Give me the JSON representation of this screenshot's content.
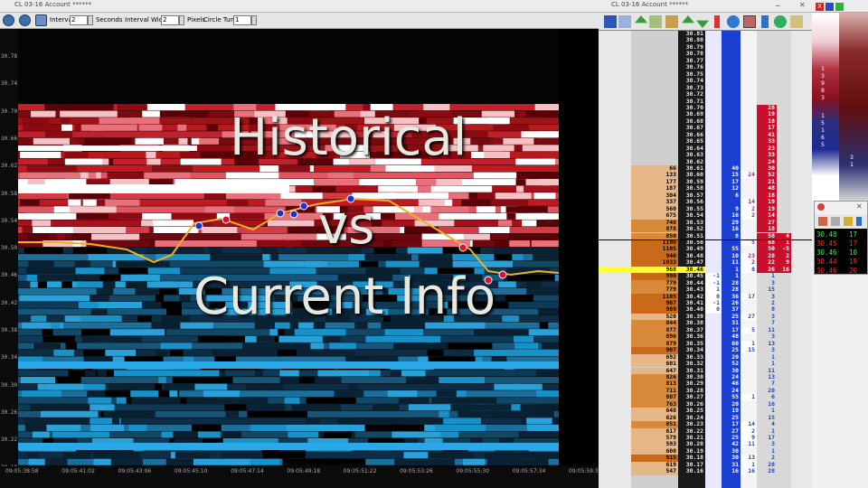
{
  "left_window": {
    "title": "CL 03-16  Account ******",
    "toolbar": {
      "interval_label": "Interval",
      "interval_value": "2",
      "seconds_label": "Seconds",
      "interval_width_label": "Interval Width",
      "interval_width_value": "2",
      "pixels_label": "Pixels",
      "circle_tuner_label": "Circle Tuner",
      "circle_tuner_value": "1"
    },
    "price_axis": [
      "30.78",
      "30.74",
      "30.70",
      "30.66",
      "30.62",
      "30.58",
      "30.54",
      "30.50",
      "30.46",
      "30.42",
      "30.38",
      "30.34",
      "30.30",
      "30.26",
      "30.22",
      "30.18"
    ],
    "time_axis": [
      "09:05:38:58",
      "09:05:41:02",
      "09:05:43:06",
      "09:05:45:10",
      "09:05:47:14",
      "09:05:49:18",
      "09:05:51:22",
      "09:05:53:26",
      "09:05:55:30",
      "09:05:57:34",
      "09:05:59:38"
    ],
    "overlay": {
      "line1": "Historical",
      "line2": "vs",
      "line3": "Current Info"
    }
  },
  "right_window": {
    "title": "CL 03-16  Account ******",
    "current_price": "30.46",
    "ladder": [
      {
        "p": "30.81",
        "v": "",
        "a": "",
        "b": "",
        "s": ""
      },
      {
        "p": "30.80",
        "v": "",
        "a": "",
        "b": "",
        "s": ""
      },
      {
        "p": "30.79",
        "v": "",
        "a": "",
        "b": "",
        "s": ""
      },
      {
        "p": "30.78",
        "v": "",
        "a": "",
        "b": "",
        "s": ""
      },
      {
        "p": "30.77",
        "v": "",
        "a": "",
        "b": "",
        "s": ""
      },
      {
        "p": "30.76",
        "v": "",
        "a": "",
        "b": "",
        "s": ""
      },
      {
        "p": "30.75",
        "v": "",
        "a": "",
        "b": "",
        "s": ""
      },
      {
        "p": "30.74",
        "v": "",
        "a": "",
        "b": "",
        "s": ""
      },
      {
        "p": "30.73",
        "v": "",
        "a": "",
        "b": "",
        "s": ""
      },
      {
        "p": "30.72",
        "v": "",
        "a": "",
        "b": "",
        "s": ""
      },
      {
        "p": "30.71",
        "v": "",
        "a": "",
        "b": "",
        "s": ""
      },
      {
        "p": "30.70",
        "v": "",
        "a": "",
        "b": "",
        "s": "28"
      },
      {
        "p": "30.69",
        "v": "",
        "a": "",
        "b": "",
        "s": "19"
      },
      {
        "p": "30.68",
        "v": "",
        "a": "",
        "b": "",
        "s": "18"
      },
      {
        "p": "30.67",
        "v": "",
        "a": "",
        "b": "",
        "s": "17"
      },
      {
        "p": "30.66",
        "v": "",
        "a": "",
        "b": "",
        "s": "41"
      },
      {
        "p": "30.65",
        "v": "",
        "a": "",
        "b": "",
        "s": "33"
      },
      {
        "p": "30.64",
        "v": "",
        "a": "",
        "b": "",
        "s": "23"
      },
      {
        "p": "30.63",
        "v": "",
        "a": "",
        "b": "",
        "s": "33"
      },
      {
        "p": "30.62",
        "v": "",
        "a": "",
        "b": "",
        "s": "24"
      },
      {
        "p": "30.61",
        "v": "66",
        "a": "",
        "b": "40",
        "s": "30"
      },
      {
        "p": "30.60",
        "v": "133",
        "a": "",
        "b": "15",
        "b2": "24",
        "s": "52"
      },
      {
        "p": "30.59",
        "v": "177",
        "a": "",
        "b": "17",
        "s": "21"
      },
      {
        "p": "30.58",
        "v": "187",
        "a": "",
        "b": "12",
        "s": "48"
      },
      {
        "p": "30.57",
        "v": "304",
        "a": "",
        "b": "6",
        "s": "18"
      },
      {
        "p": "30.56",
        "v": "337",
        "a": "",
        "b": "",
        "b2": "14",
        "s": "19"
      },
      {
        "p": "30.55",
        "v": "560",
        "a": "",
        "b": "9",
        "b2": "2",
        "s": "19"
      },
      {
        "p": "30.54",
        "v": "675",
        "a": "",
        "b": "16",
        "b2": "2",
        "s": "14"
      },
      {
        "p": "30.53",
        "v": "748",
        "a": "",
        "b": "29",
        "s": "27"
      },
      {
        "p": "30.52",
        "v": "878",
        "a": "",
        "b": "16",
        "s": "18"
      },
      {
        "p": "30.51",
        "v": "850",
        "a": "",
        "b": "8",
        "s": "58",
        "x": "4"
      },
      {
        "p": "30.50",
        "v": "1196",
        "a": "",
        "b": "",
        "b2": "5",
        "s": "68",
        "x": "1"
      },
      {
        "p": "30.49",
        "v": "1105",
        "a": "",
        "b": "55",
        "s": "50",
        "x": "-5"
      },
      {
        "p": "30.48",
        "v": "946",
        "a": "",
        "b": "10",
        "b2": "23",
        "s": "28",
        "x": "2"
      },
      {
        "p": "30.47",
        "v": "1033",
        "a": "",
        "b": "11",
        "b2": "2",
        "s": "22",
        "x": "9"
      },
      {
        "p": "30.46",
        "v": "968",
        "a": "",
        "b": "1",
        "b2": "8",
        "s": "26",
        "x": "16"
      },
      {
        "p": "30.45",
        "v": "990",
        "a": "-1",
        "b": "1",
        "b2": "",
        "bb": "1"
      },
      {
        "p": "30.44",
        "v": "779",
        "a": "-1",
        "b": "28",
        "bb": "3"
      },
      {
        "p": "30.43",
        "v": "779",
        "a": "1",
        "b": "28",
        "bb": "15"
      },
      {
        "p": "30.42",
        "v": "1105",
        "a": "0",
        "b": "36",
        "b2": "17",
        "bb": "3"
      },
      {
        "p": "30.41",
        "v": "907",
        "a": "-1",
        "b": "26",
        "bb": "2"
      },
      {
        "p": "30.40",
        "v": "989",
        "a": "0",
        "b": "37",
        "bb": "8"
      },
      {
        "p": "30.39",
        "v": "520",
        "a": "",
        "b": "25",
        "b2": "27",
        "bb": "3"
      },
      {
        "p": "30.38",
        "v": "844",
        "a": "",
        "b": "31",
        "bb": "7"
      },
      {
        "p": "30.37",
        "v": "877",
        "a": "",
        "b": "17",
        "b2": "5",
        "bb": "11"
      },
      {
        "p": "30.36",
        "v": "896",
        "a": "",
        "b": "48",
        "bb": "3"
      },
      {
        "p": "30.35",
        "v": "879",
        "a": "",
        "b": "60",
        "b2": "1",
        "bb": "13"
      },
      {
        "p": "30.34",
        "v": "907",
        "a": "",
        "b": "25",
        "b2": "15",
        "bb": "3"
      },
      {
        "p": "30.33",
        "v": "692",
        "a": "",
        "b": "20",
        "bb": "1"
      },
      {
        "p": "30.32",
        "v": "601",
        "a": "",
        "b": "52",
        "bb": "1"
      },
      {
        "p": "30.31",
        "v": "647",
        "a": "",
        "b": "30",
        "bb": "11"
      },
      {
        "p": "30.30",
        "v": "826",
        "a": "",
        "b": "24",
        "bb": "13"
      },
      {
        "p": "30.29",
        "v": "813",
        "a": "",
        "b": "46",
        "bb": "7"
      },
      {
        "p": "30.28",
        "v": "711",
        "a": "",
        "b": "24",
        "bb": "20"
      },
      {
        "p": "30.27",
        "v": "807",
        "a": "",
        "b": "55",
        "b2": "1",
        "bb": "6"
      },
      {
        "p": "30.26",
        "v": "763",
        "a": "",
        "b": "20",
        "bb": "16"
      },
      {
        "p": "30.25",
        "v": "648",
        "a": "",
        "b": "19",
        "bb": "1"
      },
      {
        "p": "30.24",
        "v": "626",
        "a": "",
        "b": "25",
        "bb": "15"
      },
      {
        "p": "30.23",
        "v": "851",
        "a": "",
        "b": "17",
        "b2": "14",
        "bb": "4"
      },
      {
        "p": "30.22",
        "v": "617",
        "a": "",
        "b": "27",
        "b2": "2",
        "bb": "1"
      },
      {
        "p": "30.21",
        "v": "579",
        "a": "",
        "b": "25",
        "b2": "9",
        "bb": "17"
      },
      {
        "p": "30.20",
        "v": "593",
        "a": "",
        "b": "42",
        "b2": "11",
        "bb": "3"
      },
      {
        "p": "30.19",
        "v": "600",
        "a": "",
        "b": "30",
        "bb": "1"
      },
      {
        "p": "30.18",
        "v": "915",
        "a": "",
        "b": "30",
        "b2": "13",
        "bb": "2"
      },
      {
        "p": "30.17",
        "v": "619",
        "a": "",
        "b": "31",
        "b2": "1",
        "bb": "28"
      },
      {
        "p": "30.16",
        "v": "547",
        "a": "",
        "b": "16",
        "b2": "16",
        "bb": "28"
      }
    ]
  },
  "mini_window": {
    "digits_top": [
      "1",
      "3",
      "9",
      "8",
      "3"
    ],
    "digits_mid": [
      "1",
      "5",
      "1",
      "6",
      "5"
    ],
    "digits_right": [
      "3",
      "1"
    ],
    "digit_six": "6",
    "popup_rows": [
      {
        "price": "30.48",
        "size": "17",
        "color": "#55dd55"
      },
      {
        "price": "30.45",
        "size": "17",
        "color": "#dd3333"
      },
      {
        "price": "30.46",
        "size": "10",
        "color": "#55dd55"
      },
      {
        "price": "30.44",
        "size": "19",
        "color": "#dd3333"
      },
      {
        "price": "30.46",
        "size": "20",
        "color": "#dd3333"
      }
    ]
  },
  "colors": {
    "ask_red": "#c8102e",
    "bid_blue": "#1b3fd0",
    "highlight_yellow": "#ffff33",
    "volume_orange": "#d88a3a"
  }
}
